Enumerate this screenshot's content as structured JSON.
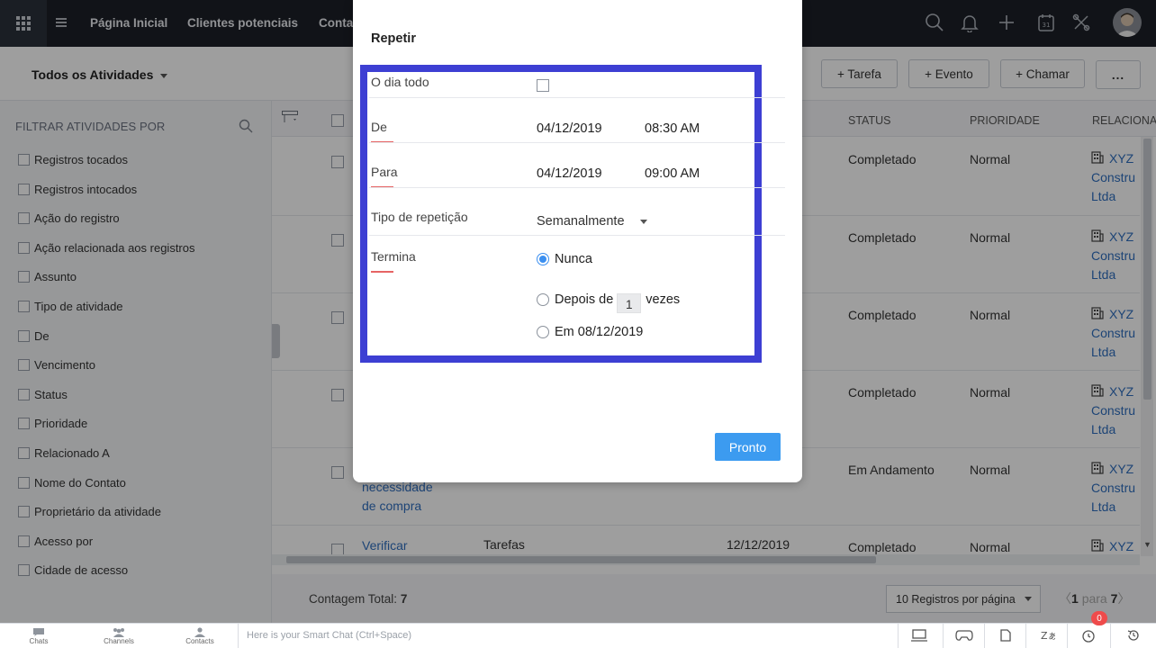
{
  "nav": {
    "items": [
      "Página Inicial",
      "Clientes potenciais",
      "Conta"
    ]
  },
  "subheader": {
    "view_label": "Todos os Atividades",
    "buttons": [
      "+ Tarefa",
      "+ Evento",
      "+ Chamar",
      "..."
    ]
  },
  "filters": {
    "title": "FILTRAR ATIVIDADES POR",
    "items": [
      "Registros tocados",
      "Registros intocados",
      "Ação do registro",
      "Ação relacionada aos registros",
      "Assunto",
      "Tipo de atividade",
      "De",
      "Vencimento",
      "Status",
      "Prioridade",
      "Relacionado A",
      "Nome do Contato",
      "Proprietário da atividade",
      "Acesso por",
      "Cidade de acesso"
    ]
  },
  "table": {
    "columns": [
      "STATUS",
      "PRIORIDADE",
      "RELACIONA"
    ],
    "rows": [
      {
        "status": "Completado",
        "priority": "Normal",
        "related": [
          "XYZ",
          "Constru",
          "Ltda"
        ]
      },
      {
        "status": "Completado",
        "priority": "Normal",
        "related": [
          "XYZ",
          "Constru",
          "Ltda"
        ]
      },
      {
        "status": "Completado",
        "priority": "Normal",
        "related": [
          "XYZ",
          "Constru",
          "Ltda"
        ]
      },
      {
        "status": "Completado",
        "priority": "Normal",
        "related": [
          "XYZ",
          "Constru",
          "Ltda"
        ]
      },
      {
        "status": "Em Andamento",
        "priority": "Normal",
        "related": [
          "XYZ",
          "Constru",
          "Ltda"
        ],
        "subject_lines": [
          "necessidade",
          "de compra"
        ]
      },
      {
        "subject": "Verificar",
        "type": "Tarefas",
        "date": "12/12/2019",
        "status": "Completado",
        "priority": "Normal",
        "related": [
          "XYZ"
        ]
      }
    ]
  },
  "footer": {
    "count_label": "Contagem Total:",
    "count_value": "7",
    "per_page": "10 Registros por página",
    "page_from": "1",
    "page_word": "para",
    "page_to": "7"
  },
  "chatbar": {
    "tabs": [
      "Chats",
      "Channels",
      "Contacts"
    ],
    "placeholder": "Here is your Smart Chat (Ctrl+Space)",
    "badge": "0"
  },
  "modal": {
    "title": "Repetir",
    "all_day_label": "O dia todo",
    "from_label": "De",
    "from_date": "04/12/2019",
    "from_time": "08:30 AM",
    "to_label": "Para",
    "to_date": "04/12/2019",
    "to_time": "09:00 AM",
    "repeat_type_label": "Tipo de repetição",
    "repeat_type_value": "Semanalmente",
    "ends_label": "Termina",
    "end_never": "Nunca",
    "end_after_prefix": "Depois de",
    "end_after_count": "1",
    "end_after_suffix": "vezes",
    "end_on": "Em 08/12/2019",
    "done_button": "Pronto"
  }
}
